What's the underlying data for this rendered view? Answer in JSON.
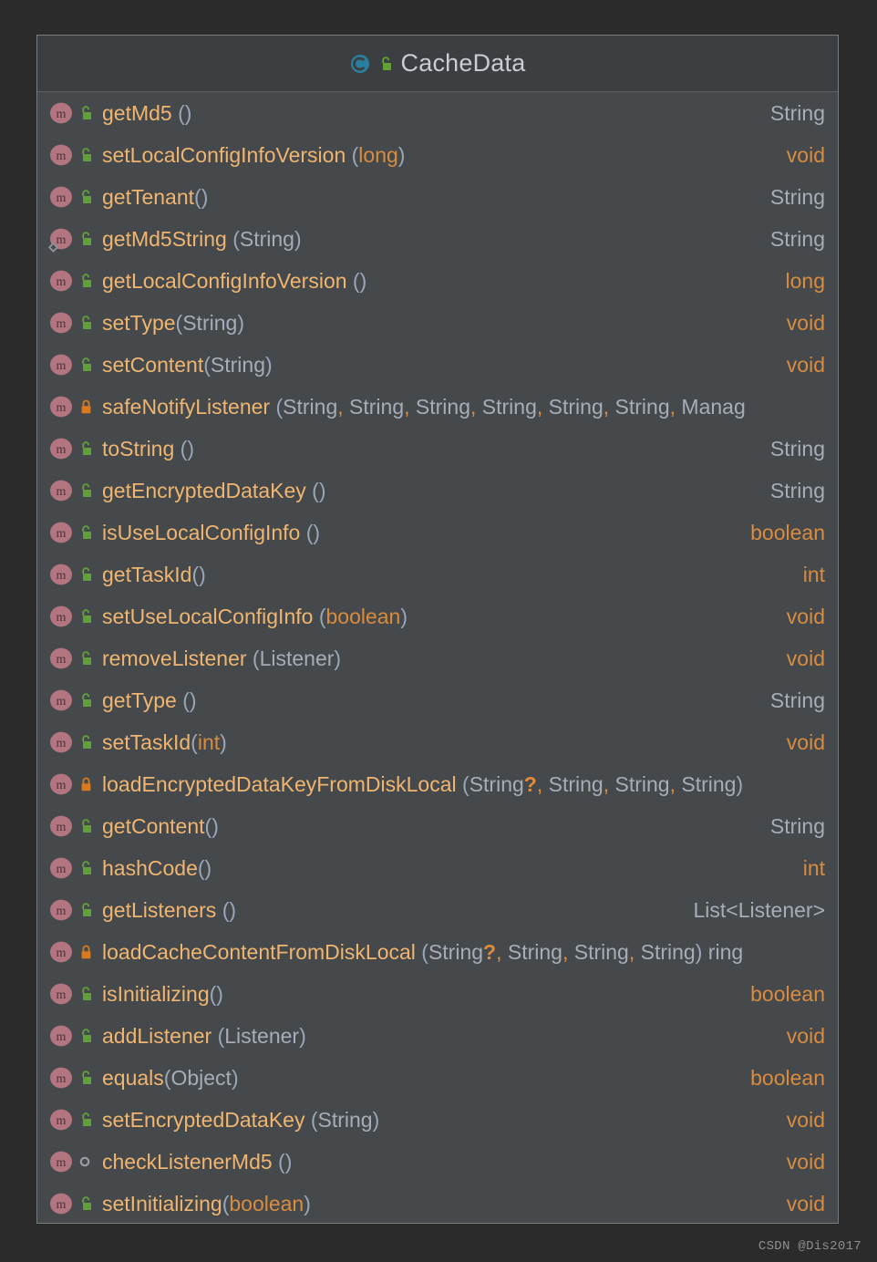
{
  "colors": {
    "window_bg": "#2b2b2b",
    "panel_bg": "#45494c",
    "header_bg": "#3c3f41",
    "panel_border": "#7a7d7e",
    "method_icon": "#b3757f",
    "class_icon": "#2b7f9e",
    "lock_public": "#62a03a",
    "lock_private": "#d97a21",
    "name_color": "#f0b570",
    "object_type_color": "#a6adb8",
    "primitive_type_color": "#d98c3f",
    "title_color": "#c9ccd1"
  },
  "header": {
    "title": "CacheData",
    "class_icon": "class-icon",
    "visibility_icon": "lock-open-green-icon"
  },
  "watermark": "CSDN @Dis2017",
  "members": [
    {
      "icon": "method-icon",
      "visibility": "public",
      "visibility_icon": "lock-open-green-icon",
      "static": false,
      "name": "getMd5",
      "space_before_paren": true,
      "params": [],
      "return_type": "String",
      "return_kind": "object"
    },
    {
      "icon": "method-icon",
      "visibility": "public",
      "visibility_icon": "lock-open-green-icon",
      "static": false,
      "name": "setLocalConfigInfoVersion",
      "space_before_paren": true,
      "params": [
        {
          "text": "long",
          "kind": "primitive"
        }
      ],
      "return_type": "void",
      "return_kind": "primitive"
    },
    {
      "icon": "method-icon",
      "visibility": "public",
      "visibility_icon": "lock-open-green-icon",
      "static": false,
      "name": "getTenant",
      "space_before_paren": false,
      "params": [],
      "return_type": "String",
      "return_kind": "object"
    },
    {
      "icon": "method-icon",
      "visibility": "public",
      "visibility_icon": "lock-open-green-icon",
      "static": true,
      "name": "getMd5String",
      "space_before_paren": true,
      "params": [
        {
          "text": "String",
          "kind": "object"
        }
      ],
      "return_type": "String",
      "return_kind": "object"
    },
    {
      "icon": "method-icon",
      "visibility": "public",
      "visibility_icon": "lock-open-green-icon",
      "static": false,
      "name": "getLocalConfigInfoVersion",
      "space_before_paren": true,
      "params": [],
      "return_type": "long",
      "return_kind": "primitive"
    },
    {
      "icon": "method-icon",
      "visibility": "public",
      "visibility_icon": "lock-open-green-icon",
      "static": false,
      "name": "setType",
      "space_before_paren": false,
      "params": [
        {
          "text": "String",
          "kind": "object"
        }
      ],
      "return_type": "void",
      "return_kind": "primitive"
    },
    {
      "icon": "method-icon",
      "visibility": "public",
      "visibility_icon": "lock-open-green-icon",
      "static": false,
      "name": "setContent",
      "space_before_paren": false,
      "params": [
        {
          "text": "String",
          "kind": "object"
        }
      ],
      "return_type": "void",
      "return_kind": "primitive"
    },
    {
      "icon": "method-icon",
      "visibility": "private",
      "visibility_icon": "lock-closed-orange-icon",
      "static": false,
      "name": "safeNotifyListener",
      "space_before_paren": true,
      "params": [
        {
          "text": "String",
          "kind": "object"
        },
        {
          "text": "String",
          "kind": "object"
        },
        {
          "text": "String",
          "kind": "object"
        },
        {
          "text": "String",
          "kind": "object"
        },
        {
          "text": "String",
          "kind": "object"
        },
        {
          "text": "String",
          "kind": "object"
        },
        {
          "text": "Manag",
          "kind": "object"
        }
      ],
      "truncated": true,
      "return_type": "",
      "return_kind": "object"
    },
    {
      "icon": "method-icon",
      "visibility": "public",
      "visibility_icon": "lock-open-green-icon",
      "static": false,
      "name": "toString",
      "space_before_paren": true,
      "params": [],
      "return_type": "String",
      "return_kind": "object"
    },
    {
      "icon": "method-icon",
      "visibility": "public",
      "visibility_icon": "lock-open-green-icon",
      "static": false,
      "name": "getEncryptedDataKey",
      "space_before_paren": true,
      "params": [],
      "return_type": "String",
      "return_kind": "object"
    },
    {
      "icon": "method-icon",
      "visibility": "public",
      "visibility_icon": "lock-open-green-icon",
      "static": false,
      "name": "isUseLocalConfigInfo",
      "space_before_paren": true,
      "params": [],
      "return_type": "boolean",
      "return_kind": "primitive"
    },
    {
      "icon": "method-icon",
      "visibility": "public",
      "visibility_icon": "lock-open-green-icon",
      "static": false,
      "name": "getTaskId",
      "space_before_paren": false,
      "params": [],
      "return_type": "int",
      "return_kind": "primitive"
    },
    {
      "icon": "method-icon",
      "visibility": "public",
      "visibility_icon": "lock-open-green-icon",
      "static": false,
      "name": "setUseLocalConfigInfo",
      "space_before_paren": true,
      "params": [
        {
          "text": "boolean",
          "kind": "primitive"
        }
      ],
      "return_type": "void",
      "return_kind": "primitive"
    },
    {
      "icon": "method-icon",
      "visibility": "public",
      "visibility_icon": "lock-open-green-icon",
      "static": false,
      "name": "removeListener",
      "space_before_paren": true,
      "params": [
        {
          "text": "Listener",
          "kind": "object"
        }
      ],
      "return_type": "void",
      "return_kind": "primitive"
    },
    {
      "icon": "method-icon",
      "visibility": "public",
      "visibility_icon": "lock-open-green-icon",
      "static": false,
      "name": "getType",
      "space_before_paren": true,
      "params": [],
      "return_type": "String",
      "return_kind": "object"
    },
    {
      "icon": "method-icon",
      "visibility": "public",
      "visibility_icon": "lock-open-green-icon",
      "static": false,
      "name": "setTaskId",
      "space_before_paren": false,
      "params": [
        {
          "text": "int",
          "kind": "primitive"
        }
      ],
      "return_type": "void",
      "return_kind": "primitive"
    },
    {
      "icon": "method-icon",
      "visibility": "private",
      "visibility_icon": "lock-closed-orange-icon",
      "static": false,
      "name": "loadEncryptedDataKeyFromDiskLocal",
      "space_before_paren": true,
      "params": [
        {
          "text": "String",
          "kind": "object",
          "nullable": true
        },
        {
          "text": "String",
          "kind": "object"
        },
        {
          "text": "String",
          "kind": "object"
        },
        {
          "text": "String",
          "kind": "object"
        }
      ],
      "return_type": "",
      "return_kind": "object"
    },
    {
      "icon": "method-icon",
      "visibility": "public",
      "visibility_icon": "lock-open-green-icon",
      "static": false,
      "name": "getContent",
      "space_before_paren": false,
      "params": [],
      "return_type": "String",
      "return_kind": "object"
    },
    {
      "icon": "method-icon",
      "visibility": "public",
      "visibility_icon": "lock-open-green-icon",
      "static": false,
      "name": "hashCode",
      "space_before_paren": false,
      "params": [],
      "return_type": "int",
      "return_kind": "primitive"
    },
    {
      "icon": "method-icon",
      "visibility": "public",
      "visibility_icon": "lock-open-green-icon",
      "static": false,
      "name": "getListeners",
      "space_before_paren": true,
      "params": [],
      "return_type": "List<Listener>",
      "return_kind": "object"
    },
    {
      "icon": "method-icon",
      "visibility": "private",
      "visibility_icon": "lock-closed-orange-icon",
      "static": false,
      "name": "loadCacheContentFromDiskLocal",
      "space_before_paren": true,
      "params": [
        {
          "text": "String",
          "kind": "object",
          "nullable": true
        },
        {
          "text": "String",
          "kind": "object"
        },
        {
          "text": "String",
          "kind": "object"
        },
        {
          "text": "String",
          "kind": "object"
        }
      ],
      "trailing_text": "ring",
      "return_type": "",
      "return_kind": "object"
    },
    {
      "icon": "method-icon",
      "visibility": "public",
      "visibility_icon": "lock-open-green-icon",
      "static": false,
      "name": "isInitializing",
      "space_before_paren": false,
      "params": [],
      "return_type": "boolean",
      "return_kind": "primitive"
    },
    {
      "icon": "method-icon",
      "visibility": "public",
      "visibility_icon": "lock-open-green-icon",
      "static": false,
      "name": "addListener",
      "space_before_paren": true,
      "params": [
        {
          "text": "Listener",
          "kind": "object"
        }
      ],
      "return_type": "void",
      "return_kind": "primitive"
    },
    {
      "icon": "method-icon",
      "visibility": "public",
      "visibility_icon": "lock-open-green-icon",
      "static": false,
      "name": "equals",
      "space_before_paren": false,
      "params": [
        {
          "text": "Object",
          "kind": "object"
        }
      ],
      "return_type": "boolean",
      "return_kind": "primitive"
    },
    {
      "icon": "method-icon",
      "visibility": "public",
      "visibility_icon": "lock-open-green-icon",
      "static": false,
      "name": "setEncryptedDataKey",
      "space_before_paren": true,
      "params": [
        {
          "text": "String",
          "kind": "object"
        }
      ],
      "return_type": "void",
      "return_kind": "primitive"
    },
    {
      "icon": "method-icon",
      "visibility": "package-private",
      "visibility_icon": "circle-grey-icon",
      "static": false,
      "name": "checkListenerMd5",
      "space_before_paren": true,
      "params": [],
      "return_type": "void",
      "return_kind": "primitive"
    },
    {
      "icon": "method-icon",
      "visibility": "public",
      "visibility_icon": "lock-open-green-icon",
      "static": false,
      "name": "setInitializing",
      "space_before_paren": false,
      "params": [
        {
          "text": "boolean",
          "kind": "primitive"
        }
      ],
      "return_type": "void",
      "return_kind": "primitive"
    }
  ]
}
